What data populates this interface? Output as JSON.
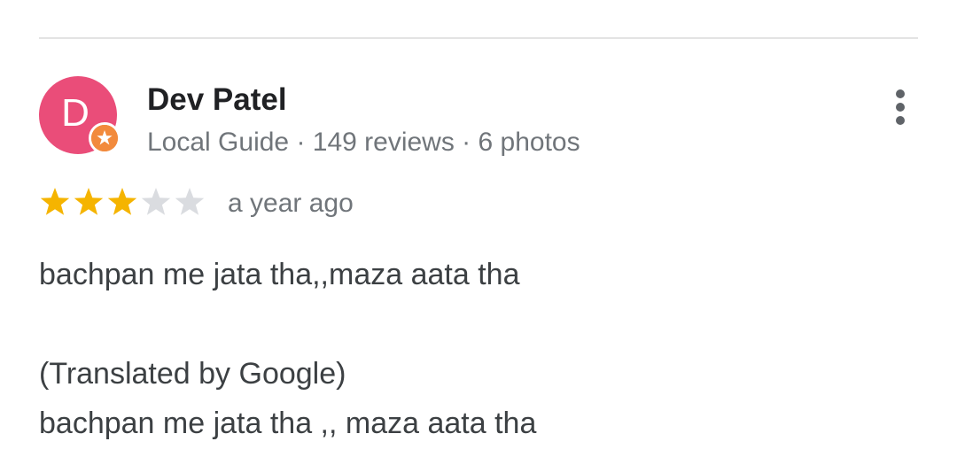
{
  "reviewer": {
    "avatar_initial": "D",
    "avatar_color": "#ea4d79",
    "badge_icon": "local-guide-star-icon",
    "badge_color": "#f28a3c",
    "name": "Dev Patel",
    "meta": "Local Guide · 149 reviews · 6 photos"
  },
  "more_menu_icon": "more-vert-icon",
  "rating": {
    "value": 3,
    "max": 5,
    "filled_color": "#f5b400",
    "empty_color": "#dadce0"
  },
  "date": "a year ago",
  "review": {
    "original": "bachpan me jata tha,,maza aata tha",
    "translated_label": "(Translated by Google)",
    "translated": "bachpan me jata tha ,, maza aata tha"
  }
}
